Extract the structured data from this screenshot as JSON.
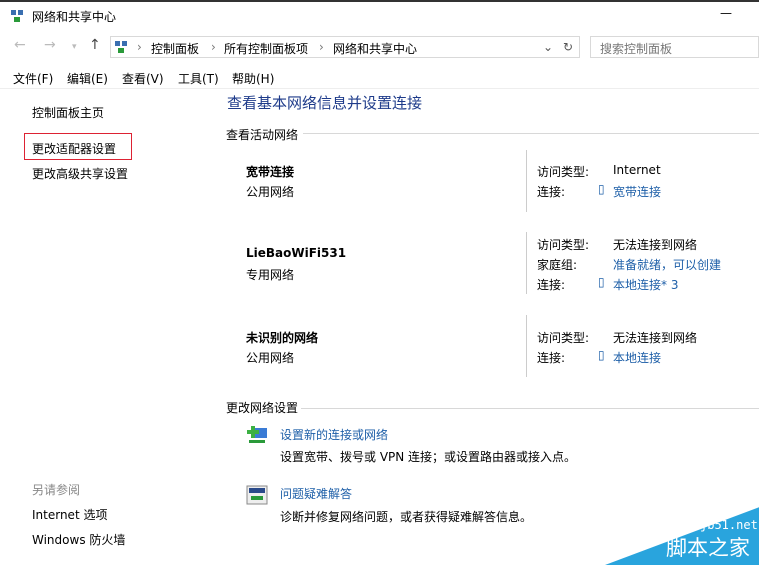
{
  "window": {
    "title": "网络和共享中心",
    "minimize": "—"
  },
  "address": {
    "crumbs": [
      "控制面板",
      "所有控制面板项",
      "网络和共享中心"
    ],
    "search_placeholder": "搜索控制面板"
  },
  "menu": [
    "文件(F)",
    "编辑(E)",
    "查看(V)",
    "工具(T)",
    "帮助(H)"
  ],
  "sidebar": {
    "items": [
      "控制面板主页",
      "更改适配器设置",
      "更改高级共享设置"
    ],
    "see_also": "另请参阅",
    "see_also_items": [
      "Internet 选项",
      "Windows 防火墙"
    ]
  },
  "main": {
    "heading": "查看基本网络信息并设置连接",
    "active_section": "查看活动网络",
    "networks": [
      {
        "name": "宽带连接",
        "type": "公用网络",
        "rows": [
          {
            "label": "访问类型:",
            "value": "Internet",
            "link": false
          },
          {
            "label": "连接:",
            "value": "宽带连接",
            "link": true
          }
        ]
      },
      {
        "name": "LieBaoWiFi531",
        "type": "专用网络",
        "rows": [
          {
            "label": "访问类型:",
            "value": "无法连接到网络",
            "link": false
          },
          {
            "label": "家庭组:",
            "value": "准备就绪，可以创建",
            "link": true
          },
          {
            "label": "连接:",
            "value": "本地连接* 3",
            "link": true
          }
        ]
      },
      {
        "name": "未识别的网络",
        "type": "公用网络",
        "rows": [
          {
            "label": "访问类型:",
            "value": "无法连接到网络",
            "link": false
          },
          {
            "label": "连接:",
            "value": "本地连接",
            "link": true
          }
        ]
      }
    ],
    "change_section": "更改网络设置",
    "tasks": [
      {
        "title": "设置新的连接或网络",
        "desc": "设置宽带、拨号或 VPN 连接；或设置路由器或接入点。",
        "icon": "new-connection-icon"
      },
      {
        "title": "问题疑难解答",
        "desc": "诊断并修复网络问题，或者获得疑难解答信息。",
        "icon": "troubleshoot-icon"
      }
    ]
  },
  "watermark": {
    "site": "jb51.net",
    "name": "脚本之家"
  }
}
